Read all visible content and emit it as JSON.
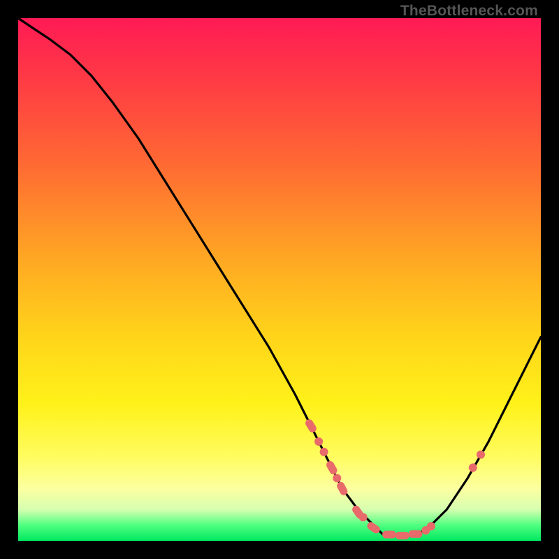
{
  "watermark": "TheBottleneck.com",
  "chart_data": {
    "type": "line",
    "title": "",
    "xlabel": "",
    "ylabel": "",
    "xlim": [
      0,
      100
    ],
    "ylim": [
      0,
      100
    ],
    "grid": false,
    "series": [
      {
        "name": "curve",
        "color": "#000000",
        "x": [
          0,
          3,
          6,
          10,
          14,
          18,
          23,
          28,
          33,
          38,
          43,
          48,
          53,
          56,
          58,
          60,
          62,
          65,
          68,
          70,
          72,
          75,
          78,
          82,
          86,
          90,
          94,
          98,
          100
        ],
        "y": [
          100,
          98,
          96,
          93,
          89,
          84,
          77,
          69,
          61,
          53,
          45,
          37,
          28,
          22,
          18,
          14,
          10,
          6,
          3,
          1,
          1,
          1,
          2,
          6,
          12,
          19,
          27,
          35,
          39
        ]
      }
    ],
    "markers": [
      {
        "x": 56,
        "y": 22,
        "color": "#e86a6a",
        "type": "pill",
        "angle": 58
      },
      {
        "x": 57.5,
        "y": 19,
        "color": "#e86a6a",
        "type": "dot"
      },
      {
        "x": 58.5,
        "y": 17,
        "color": "#e86a6a",
        "type": "dot"
      },
      {
        "x": 60,
        "y": 14,
        "color": "#e86a6a",
        "type": "pill",
        "angle": 60
      },
      {
        "x": 61,
        "y": 12,
        "color": "#e86a6a",
        "type": "dot"
      },
      {
        "x": 62,
        "y": 10,
        "color": "#e86a6a",
        "type": "pill",
        "angle": 62
      },
      {
        "x": 65,
        "y": 5.5,
        "color": "#e86a6a",
        "type": "pill",
        "angle": 55
      },
      {
        "x": 66,
        "y": 4.5,
        "color": "#e86a6a",
        "type": "dot"
      },
      {
        "x": 68,
        "y": 2.5,
        "color": "#e86a6a",
        "type": "pill",
        "angle": 35
      },
      {
        "x": 71,
        "y": 1.2,
        "color": "#e86a6a",
        "type": "pill",
        "angle": 0
      },
      {
        "x": 73.5,
        "y": 1.0,
        "color": "#e86a6a",
        "type": "pill",
        "angle": 0
      },
      {
        "x": 76,
        "y": 1.3,
        "color": "#e86a6a",
        "type": "pill",
        "angle": 0
      },
      {
        "x": 78,
        "y": 2.0,
        "color": "#e86a6a",
        "type": "dot"
      },
      {
        "x": 79,
        "y": 2.8,
        "color": "#e86a6a",
        "type": "dot"
      },
      {
        "x": 87,
        "y": 14,
        "color": "#e86a6a",
        "type": "dot"
      },
      {
        "x": 88.5,
        "y": 16.5,
        "color": "#e86a6a",
        "type": "dot"
      }
    ],
    "gradient_stops": [
      {
        "pos": 0,
        "color": "#ff1a55"
      },
      {
        "pos": 12,
        "color": "#ff3b44"
      },
      {
        "pos": 28,
        "color": "#ff6a33"
      },
      {
        "pos": 45,
        "color": "#ffa424"
      },
      {
        "pos": 60,
        "color": "#ffd21a"
      },
      {
        "pos": 74,
        "color": "#fff21a"
      },
      {
        "pos": 84,
        "color": "#fffc60"
      },
      {
        "pos": 90,
        "color": "#fcffa0"
      },
      {
        "pos": 94,
        "color": "#d6ffb0"
      },
      {
        "pos": 97,
        "color": "#50ff80"
      },
      {
        "pos": 100,
        "color": "#00e860"
      }
    ]
  }
}
